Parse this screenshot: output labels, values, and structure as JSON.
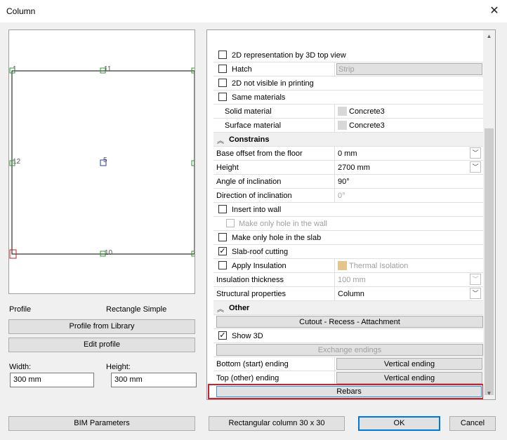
{
  "window": {
    "title": "Column"
  },
  "preview": {
    "point_labels": [
      "1",
      "11",
      "12",
      "5",
      "10"
    ]
  },
  "left": {
    "profile_label": "Profile",
    "profile_value": "Rectangle Simple",
    "profile_from_library": "Profile from Library",
    "edit_profile": "Edit profile",
    "width_label": "Width:",
    "height_label": "Height:",
    "width_value": "300 mm",
    "height_value": "300 mm",
    "bim_parameters": "BIM Parameters"
  },
  "grid": {
    "rows": {
      "r2d_top": "2D representation by 3D top view",
      "hatch": "Hatch",
      "hatch_value": "Strip",
      "not_visible": "2D not visible in printing",
      "same_materials": "Same materials",
      "solid_material": "Solid material",
      "solid_material_value": "Concrete3",
      "surface_material": "Surface material",
      "surface_material_value": "Concrete3",
      "constrains": "Constrains",
      "base_offset": "Base offset from the floor",
      "base_offset_value": "0 mm",
      "height": "Height",
      "height_value": "2700 mm",
      "angle": "Angle of inclination",
      "angle_value": "90°",
      "direction": "Direction of inclination",
      "direction_value": "0°",
      "insert_wall": "Insert into wall",
      "hole_wall": "Make only hole in the wall",
      "hole_slab": "Make only hole in the slab",
      "slab_roof": "Slab-roof cutting",
      "apply_insulation": "Apply Insulation",
      "insulation_value": "Thermal Isolation",
      "insulation_thickness": "Insulation thickness",
      "insulation_thickness_value": "100 mm",
      "structural": "Structural properties",
      "structural_value": "Column",
      "other": "Other",
      "cutout": "Cutout - Recess - Attachment",
      "show3d": "Show 3D",
      "exchange": "Exchange endings",
      "bottom_ending": "Bottom (start) ending",
      "bottom_ending_value": "Vertical ending",
      "top_ending": "Top (other) ending",
      "top_ending_value": "Vertical ending",
      "rebars": "Rebars"
    }
  },
  "footer": {
    "preset": "Rectangular column 30 x 30",
    "ok": "OK",
    "cancel": "Cancel"
  },
  "icons": {
    "close": "close-icon",
    "collapse": "collapse-icon",
    "dropdown": "chevron-down-icon",
    "check": "checkmark-icon"
  },
  "colors": {
    "highlight_border": "#d0202a",
    "ok_border": "#0078d7",
    "rebars_border": "#3c8fd6",
    "point_green": "#2a9a2a",
    "point_blue": "#2040a0",
    "point_red": "#c02020"
  }
}
